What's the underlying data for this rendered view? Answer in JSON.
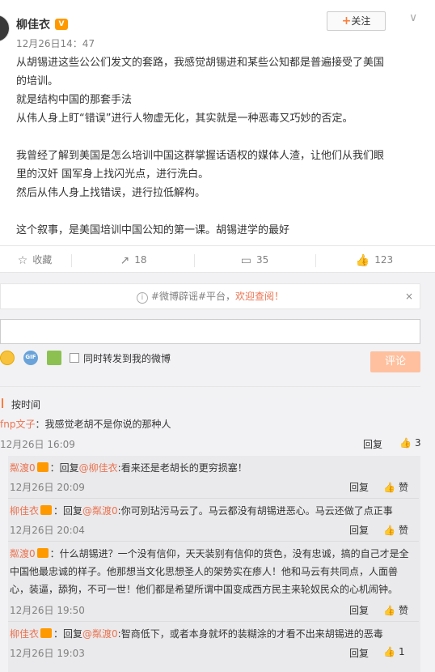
{
  "post": {
    "author": "柳佳衣",
    "time": "12月26日14：47",
    "follow_label": "关注",
    "follow_plus": "+",
    "chevron": "∨",
    "paragraphs": [
      "从胡锡进这些公公们发文的套路，我感觉胡锡进和某些公知都是普遍接受了美国",
      "的培训。",
      "就是结构中国的那套手法",
      "从伟人身上盯“错误”进行人物虚无化，其实就是一种恶毒又巧妙的否定。",
      "",
      "我曾经了解到美国是怎么培训中国这群掌握话语权的媒体人渣，让他们从我们眼",
      "里的汉奸 国军身上找闪光点，进行洗白。",
      "然后从伟人身上找错误，进行拉低解构。",
      "",
      "这个叙事，是美国培训中国公知的第一课。胡锡进学的最好"
    ]
  },
  "actions": {
    "favorite": "收藏",
    "repost_count": "18",
    "comment_count": "35",
    "like_count": "123"
  },
  "icons": {
    "favorite": "☆",
    "repost": "↗",
    "comment": "▭",
    "like": "👍",
    "info": "i",
    "close": "×"
  },
  "notice": {
    "text": "#微博辟谣#平台，",
    "highlight": "欢迎查阅！",
    "close": "×"
  },
  "composer": {
    "placeholder": "",
    "gif_label": "GIF",
    "repost_label": "同时转发到我的微博",
    "submit_label": "评论"
  },
  "sort": {
    "label": "按时间"
  },
  "comments": [
    {
      "author": "fnp文子",
      "text": "：我感觉老胡不是你说的那种人",
      "time": "12月26日 16:09",
      "reply": "回复",
      "likes": "3"
    }
  ],
  "replies": [
    {
      "author": "粼渡0",
      "prefix": "：回复",
      "target": "@柳佳衣",
      "text": ":看来还是老胡长的更穷损塞！",
      "time": "12月26日 20:09",
      "reply": "回复",
      "likes": "赞"
    },
    {
      "author": "柳佳衣",
      "prefix": "：回复",
      "target": "@粼渡0",
      "text": ":你可别玷污马云了。马云都没有胡锡进恶心。马云还做了点正事",
      "time": "12月26日 20:04",
      "reply": "回复",
      "likes": "赞"
    },
    {
      "author": "粼渡0",
      "line1": "：什么胡锡进？一个没有信仰，天天装别有信仰的货色，没有忠诚，搞的自己才是全",
      "line2": "中国他最忠诚的样子。他那想当文化思想圣人的架势实在瘆人！他和马云有共同点，人面兽",
      "line3": "心，装逼，舔狗，不可一世！他们都是希望所谓中国变成西方民主来轮奴民众的心机闹钟。",
      "time": "12月26日 19:50",
      "reply": "回复",
      "likes": "赞"
    },
    {
      "author": "柳佳衣",
      "prefix": "：回复",
      "target": "@粼渡0",
      "text": ":智商低下，或者本身就坏的装糊涂的才看不出来胡锡进的恶毒",
      "time": "12月26日 19:03",
      "reply": "回复",
      "likes": "1"
    }
  ]
}
